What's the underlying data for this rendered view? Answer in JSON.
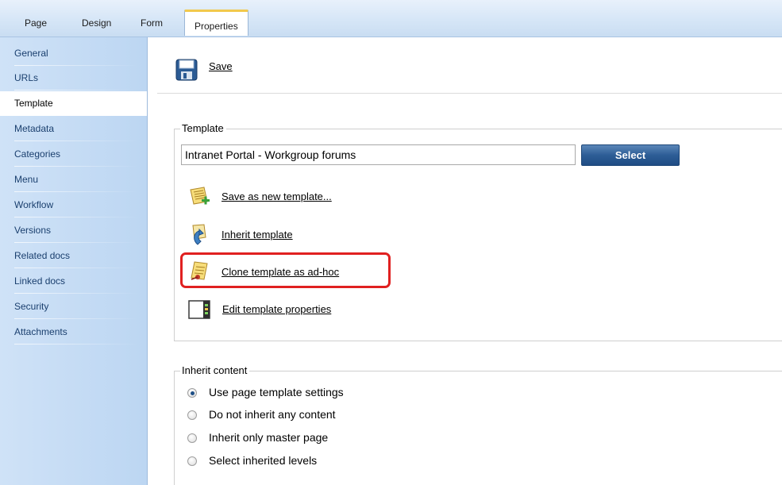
{
  "tabs": [
    {
      "label": "Page",
      "active": false
    },
    {
      "label": "Design",
      "active": false
    },
    {
      "label": "Form",
      "active": false
    },
    {
      "label": "Properties",
      "active": true
    }
  ],
  "sidebar": {
    "items": [
      {
        "label": "General"
      },
      {
        "label": "URLs"
      },
      {
        "label": "Template",
        "active": true
      },
      {
        "label": "Metadata"
      },
      {
        "label": "Categories"
      },
      {
        "label": "Menu"
      },
      {
        "label": "Workflow"
      },
      {
        "label": "Versions"
      },
      {
        "label": "Related docs"
      },
      {
        "label": "Linked docs"
      },
      {
        "label": "Security"
      },
      {
        "label": "Attachments"
      }
    ]
  },
  "toolbar": {
    "save_label": "Save",
    "save_icon": "floppy-disk-icon"
  },
  "template_group": {
    "legend": "Template",
    "value": "Intranet Portal - Workgroup forums",
    "select_label": "Select",
    "actions": [
      {
        "label": "Save as new template...",
        "icon": "new-template-icon"
      },
      {
        "label": "Inherit template",
        "icon": "inherit-template-icon"
      },
      {
        "label": "Clone template as ad-hoc",
        "icon": "clone-template-icon",
        "highlighted": true
      },
      {
        "label": "Edit template properties",
        "icon": "edit-properties-icon"
      }
    ]
  },
  "inherit_group": {
    "legend": "Inherit content",
    "options": [
      {
        "label": "Use page template settings",
        "checked": true
      },
      {
        "label": "Do not inherit any content",
        "checked": false
      },
      {
        "label": "Inherit only master page",
        "checked": false
      },
      {
        "label": "Select inherited levels",
        "checked": false
      }
    ]
  },
  "colors": {
    "accent": "#2d5d96",
    "highlight": "#e02020",
    "sidebar": "#c6dcf4",
    "active_tab_top": "#f2c94c"
  }
}
